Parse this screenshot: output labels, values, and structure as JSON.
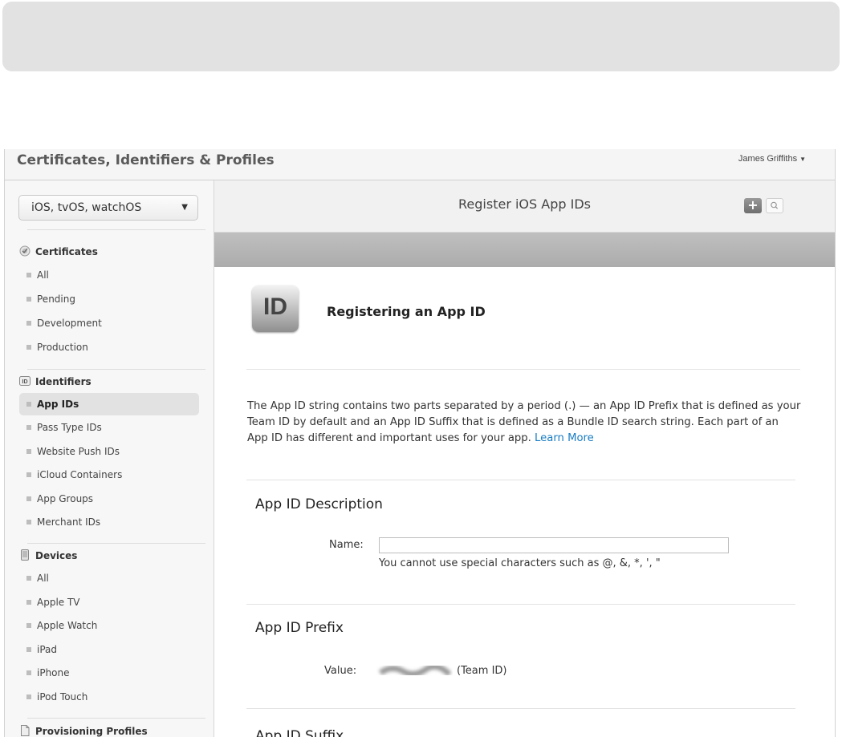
{
  "header": {
    "title": "Certificates, Identifiers & Profiles",
    "user": "James Griffiths",
    "user_caret": "▼"
  },
  "sidebar": {
    "platform": {
      "label": "iOS, tvOS, watchOS",
      "caret": "▼"
    },
    "certificates": {
      "label": "Certificates",
      "icon": "certificate-seal-icon",
      "items": [
        "All",
        "Pending",
        "Development",
        "Production"
      ]
    },
    "identifiers": {
      "label": "Identifiers",
      "icon": "id-badge-icon",
      "items": [
        "App IDs",
        "Pass Type IDs",
        "Website Push IDs",
        "iCloud Containers",
        "App Groups",
        "Merchant IDs"
      ],
      "active": "App IDs"
    },
    "devices": {
      "label": "Devices",
      "icon": "device-icon",
      "items": [
        "All",
        "Apple TV",
        "Apple Watch",
        "iPad",
        "iPhone",
        "iPod Touch"
      ]
    },
    "profiles": {
      "label": "Provisioning Profiles",
      "icon": "document-icon"
    }
  },
  "main": {
    "title": "Register iOS App IDs",
    "add_label": "+",
    "icon_text": "ID",
    "reg_title": "Registering an App ID",
    "intro": "The App ID string contains two parts separated by a period (.) — an App ID Prefix that is defined as your Team ID by default and an App ID Suffix that is defined as a Bundle ID search string. Each part of an App ID has different and important uses for your app.",
    "learn_more": "Learn More",
    "description": {
      "heading": "App ID Description",
      "name_label": "Name:",
      "name_value": "",
      "hint": "You cannot use special characters such as @, &, *, ', \""
    },
    "prefix": {
      "heading": "App ID Prefix",
      "value_label": "Value:",
      "team_suffix": "(Team ID)"
    },
    "suffix": {
      "heading": "App ID Suffix"
    }
  },
  "colors": {
    "link": "#1a7dc4",
    "active_item_bg": "#e2e2e2",
    "header_bar": "#b5b5b5"
  }
}
